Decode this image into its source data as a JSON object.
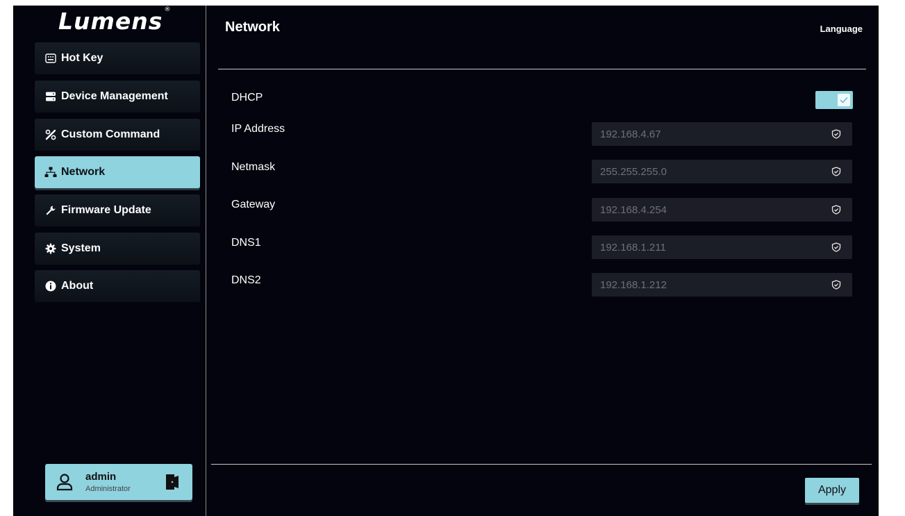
{
  "brand": {
    "logo_text": "Lumens",
    "registered_mark": "®"
  },
  "sidebar": {
    "items": [
      {
        "label": "Hot Key",
        "icon": "keyboard-icon"
      },
      {
        "label": "Device Management",
        "icon": "server-icon"
      },
      {
        "label": "Custom Command",
        "icon": "tools-icon"
      },
      {
        "label": "Network",
        "icon": "network-icon",
        "active": true
      },
      {
        "label": "Firmware Update",
        "icon": "wrench-icon"
      },
      {
        "label": "System",
        "icon": "gear-icon"
      },
      {
        "label": "About",
        "icon": "info-icon"
      }
    ]
  },
  "user": {
    "name": "admin",
    "role": "Administrator"
  },
  "header": {
    "title": "Network",
    "language_label": "Language"
  },
  "form": {
    "dhcp_label": "DHCP",
    "dhcp_enabled": true,
    "fields": [
      {
        "label": "IP Address",
        "value": "192.168.4.67"
      },
      {
        "label": "Netmask",
        "value": "255.255.255.0"
      },
      {
        "label": "Gateway",
        "value": "192.168.4.254"
      },
      {
        "label": "DNS1",
        "value": "192.168.1.211"
      },
      {
        "label": "DNS2",
        "value": "192.168.1.212"
      }
    ]
  },
  "footer": {
    "apply_label": "Apply"
  },
  "colors": {
    "accent": "#8fd3df",
    "background": "#04040e",
    "field_bg": "#1c1e27"
  }
}
